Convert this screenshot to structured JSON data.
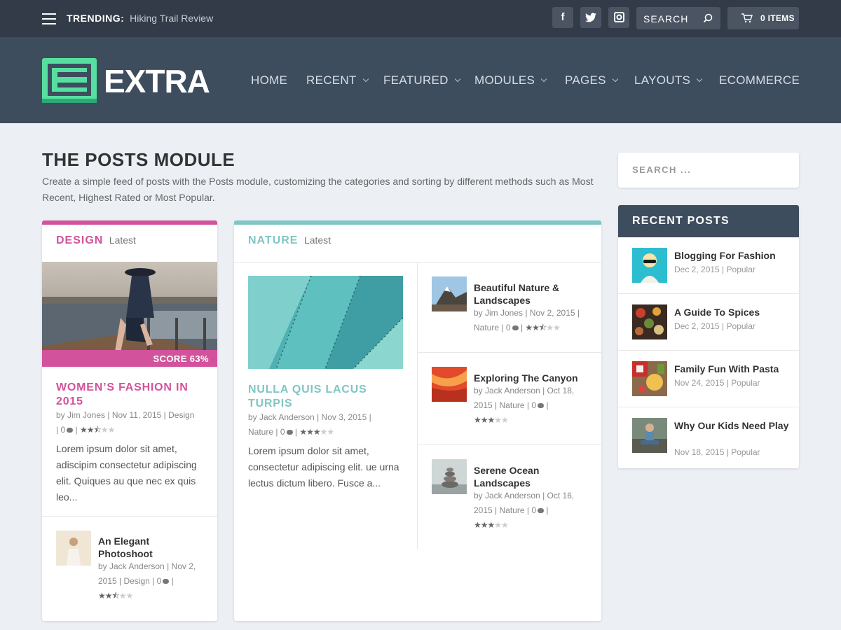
{
  "topbar": {
    "trending_label": "TRENDING:",
    "trending_value": "Hiking Trail Review",
    "social": [
      "facebook-icon",
      "twitter-icon",
      "instagram-icon"
    ],
    "search_label": "SEARCH",
    "cart_label": "0 ITEMS"
  },
  "header": {
    "logo_text": "EXTRA",
    "nav": [
      {
        "label": "HOME",
        "dropdown": false
      },
      {
        "label": "RECENT",
        "dropdown": true
      },
      {
        "label": "FEATURED",
        "dropdown": true
      },
      {
        "label": "MODULES",
        "dropdown": true
      },
      {
        "label": "PAGES",
        "dropdown": true
      },
      {
        "label": "LAYOUTS",
        "dropdown": true
      },
      {
        "label": "ECOMMERCE",
        "dropdown": false
      }
    ]
  },
  "main": {
    "title": "THE POSTS MODULE",
    "description": "Create a simple feed of posts with the Posts module, customizing the categories and sorting by different methods such as Most Recent, Highest Rated or Most Popular."
  },
  "colors": {
    "design": "#d2529b",
    "nature": "#7fc6c4",
    "header": "#3e4d5e",
    "topbar": "#323b47"
  },
  "design_module": {
    "category": "DESIGN",
    "sort": "Latest",
    "score": "SCORE 63%",
    "featured": {
      "title": "WOMEN’S FASHION IN 2015",
      "author": "by Jim Jones",
      "date": "Nov 11, 2015",
      "category": "Design",
      "comments": "0",
      "rating": 2.5,
      "excerpt": "Lorem ipsum dolor sit amet, adiscipim consectetur adipiscing elit. Quiques au que nec ex quis leo..."
    },
    "small": {
      "title": "An Elegant Photoshoot",
      "author": "by Jack Anderson",
      "date": "Nov 2,",
      "date2": "2015",
      "category": "Design",
      "comments": "0",
      "rating": 2.5
    }
  },
  "nature_module": {
    "category": "NATURE",
    "sort": "Latest",
    "featured": {
      "title": "NULLA QUIS LACUS TURPIS",
      "author": "by Jack Anderson",
      "date": "Nov 3, 2015",
      "category": "Nature",
      "comments": "0",
      "rating": 3,
      "excerpt": "Lorem ipsum dolor sit amet, consectetur adipiscing elit. ue urna lectus dictum libero. Fusce a..."
    },
    "list": [
      {
        "title": "Beautiful Nature & Landscapes",
        "author": "by Jim Jones",
        "date": "Nov 2, 2015",
        "category": "Nature",
        "comments": "0",
        "rating": 2.5
      },
      {
        "title": "Exploring The Canyon",
        "author": "by Jack Anderson",
        "date": "Oct 18,",
        "date2": "2015",
        "category": "Nature",
        "comments": "0",
        "rating": 3
      },
      {
        "title": "Serene Ocean Landscapes",
        "author": "by Jack Anderson",
        "date": "Oct 16,",
        "date2": "2015",
        "category": "Nature",
        "comments": "0",
        "rating": 3
      }
    ]
  },
  "sidebar": {
    "search_placeholder": "SEARCH ...",
    "recent_title": "RECENT POSTS",
    "posts": [
      {
        "title": "Blogging For Fashion",
        "date": "Dec 2, 2015",
        "tag": "Popular"
      },
      {
        "title": "A Guide To Spices",
        "date": "Dec 2, 2015",
        "tag": "Popular"
      },
      {
        "title": "Family Fun With Pasta",
        "date": "Nov 24, 2015",
        "tag": "Popular"
      },
      {
        "title": "Why Our Kids Need Play",
        "date": "Nov 18, 2015",
        "tag": "Popular"
      }
    ]
  }
}
